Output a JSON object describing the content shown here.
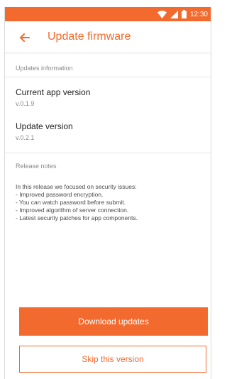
{
  "colors": {
    "accent": "#f26a2e",
    "background": "#ffffff",
    "section_header": "#8a8a8a",
    "primary_text": "#222222",
    "secondary_text": "#888888",
    "divider": "#e6e6e6"
  },
  "status_bar": {
    "time": "12:30",
    "icons": [
      "wifi-icon",
      "signal-icon",
      "battery-icon"
    ]
  },
  "toolbar": {
    "back_icon": "arrow-left-icon",
    "title": "Update firmware"
  },
  "updates_info": {
    "header": "Updates information",
    "current": {
      "label": "Current app version",
      "value": "v.0.1.9"
    },
    "update": {
      "label": "Update version",
      "value": "v.0.2.1"
    }
  },
  "release_notes": {
    "header": "Release notes",
    "lines": [
      "In this release we focused on security issues:",
      "- Improved password encryption.",
      "- You can watch password before submit.",
      "- Improved algorithm of server connection.",
      "- Latest security patches for app components."
    ]
  },
  "actions": {
    "download_label": "Download updates",
    "skip_label": "Skip this version"
  }
}
